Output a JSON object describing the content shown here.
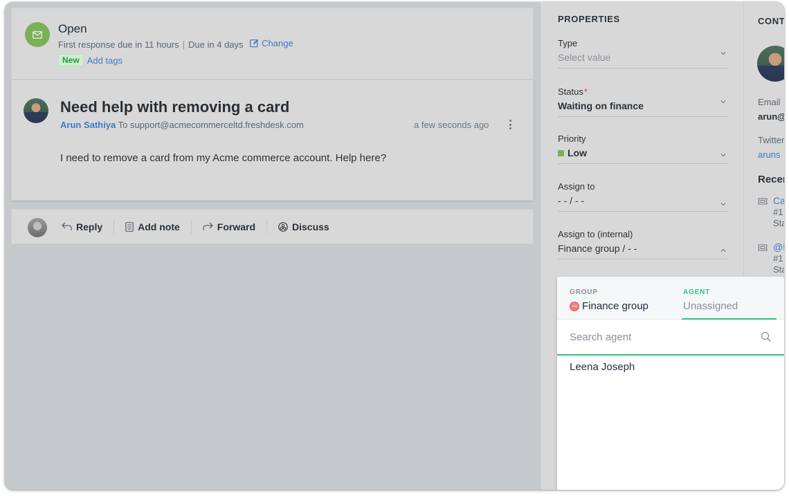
{
  "ticket_status": {
    "icon": "email-icon",
    "title": "Open",
    "first_response": "First response due in 11 hours",
    "separator": "|",
    "due": "Due in 4 days",
    "change_label": "Change",
    "badge": "New",
    "add_tags_label": "Add tags"
  },
  "ticket": {
    "subject": "Need help with removing a card",
    "sender": "Arun Sathiya",
    "to_label": "To",
    "recipient": "support@acmecommerceltd.freshdesk.com",
    "time": "a few seconds ago",
    "body": "I need to remove a card from my Acme commerce account. Help here?"
  },
  "actions": [
    {
      "label": "Reply",
      "icon": "reply-icon"
    },
    {
      "label": "Add note",
      "icon": "note-icon"
    },
    {
      "label": "Forward",
      "icon": "forward-icon"
    },
    {
      "label": "Discuss",
      "icon": "discuss-icon"
    }
  ],
  "properties": {
    "title": "PROPERTIES",
    "fields": [
      {
        "label": "Type",
        "value": "Select value",
        "placeholder": true
      },
      {
        "label": "Status",
        "required": "*",
        "value": "Waiting on finance"
      },
      {
        "label": "Priority",
        "value": "Low",
        "color": "#7bb057"
      },
      {
        "label": "Assign to",
        "value": "- - / - -"
      },
      {
        "label": "Assign to (internal)",
        "value": "Finance group / - -",
        "expanded": true
      }
    ]
  },
  "contact": {
    "title": "CONTACT",
    "email_label": "Email",
    "email_value": "arun@",
    "twitter_label": "Twitter",
    "twitter_value": "aruns",
    "recent_label": "Recent",
    "recent": [
      {
        "title": "Ca",
        "number": "#1",
        "status": "Sta"
      },
      {
        "title": "@F",
        "number": "#1",
        "status": "Sta"
      }
    ]
  },
  "assign_dropdown": {
    "group_tab_label": "GROUP",
    "group_value": "Finance group",
    "agent_tab_label": "AGENT",
    "agent_value": "Unassigned",
    "search_placeholder": "Search agent",
    "options": [
      "Leena Joseph"
    ],
    "accent_color": "#2ec27e"
  }
}
